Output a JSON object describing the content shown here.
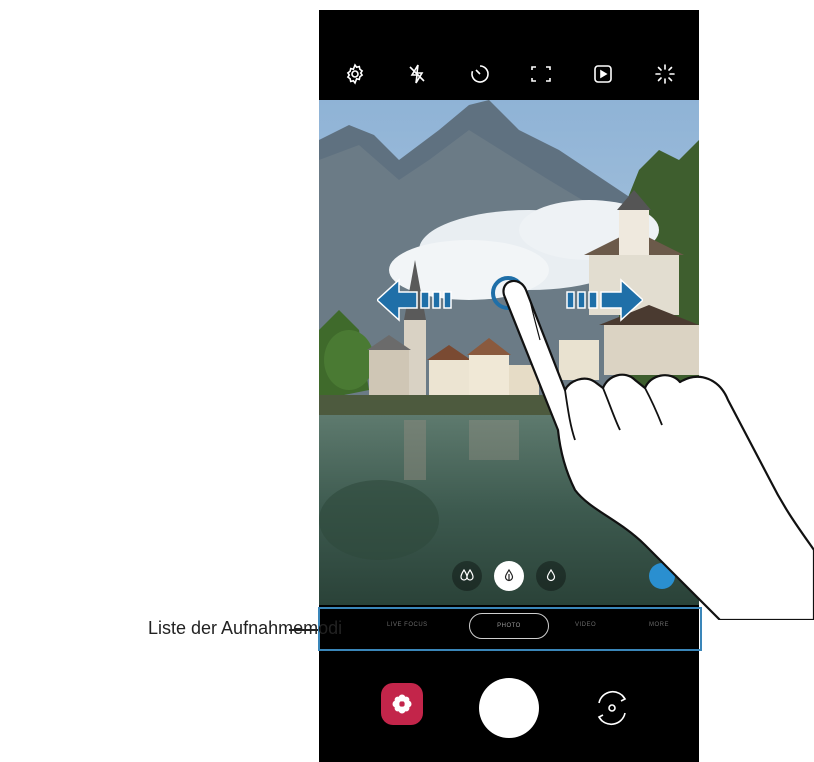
{
  "callout": {
    "label": "Liste der Aufnahmemodi"
  },
  "top_bar": {
    "icons": [
      "settings-icon",
      "flash-off-icon",
      "timer-icon",
      "aspect-ratio-icon",
      "motion-photo-icon",
      "filter-effects-icon"
    ]
  },
  "filters": {
    "items": [
      "filter-soft-icon",
      "filter-standard-icon",
      "filter-sharp-icon"
    ],
    "selected_index": 1
  },
  "modes": {
    "items": [
      "LIVE FOCUS",
      "PHOTO",
      "VIDEO",
      "MORE"
    ],
    "selected": "PHOTO"
  },
  "bottom_bar": {
    "icons": [
      "gallery-icon",
      "shutter-button",
      "switch-camera-icon"
    ]
  },
  "colors": {
    "accent": "#1f6fa8",
    "callout_border": "#3a86b9",
    "gallery_red": "#c3254a"
  }
}
